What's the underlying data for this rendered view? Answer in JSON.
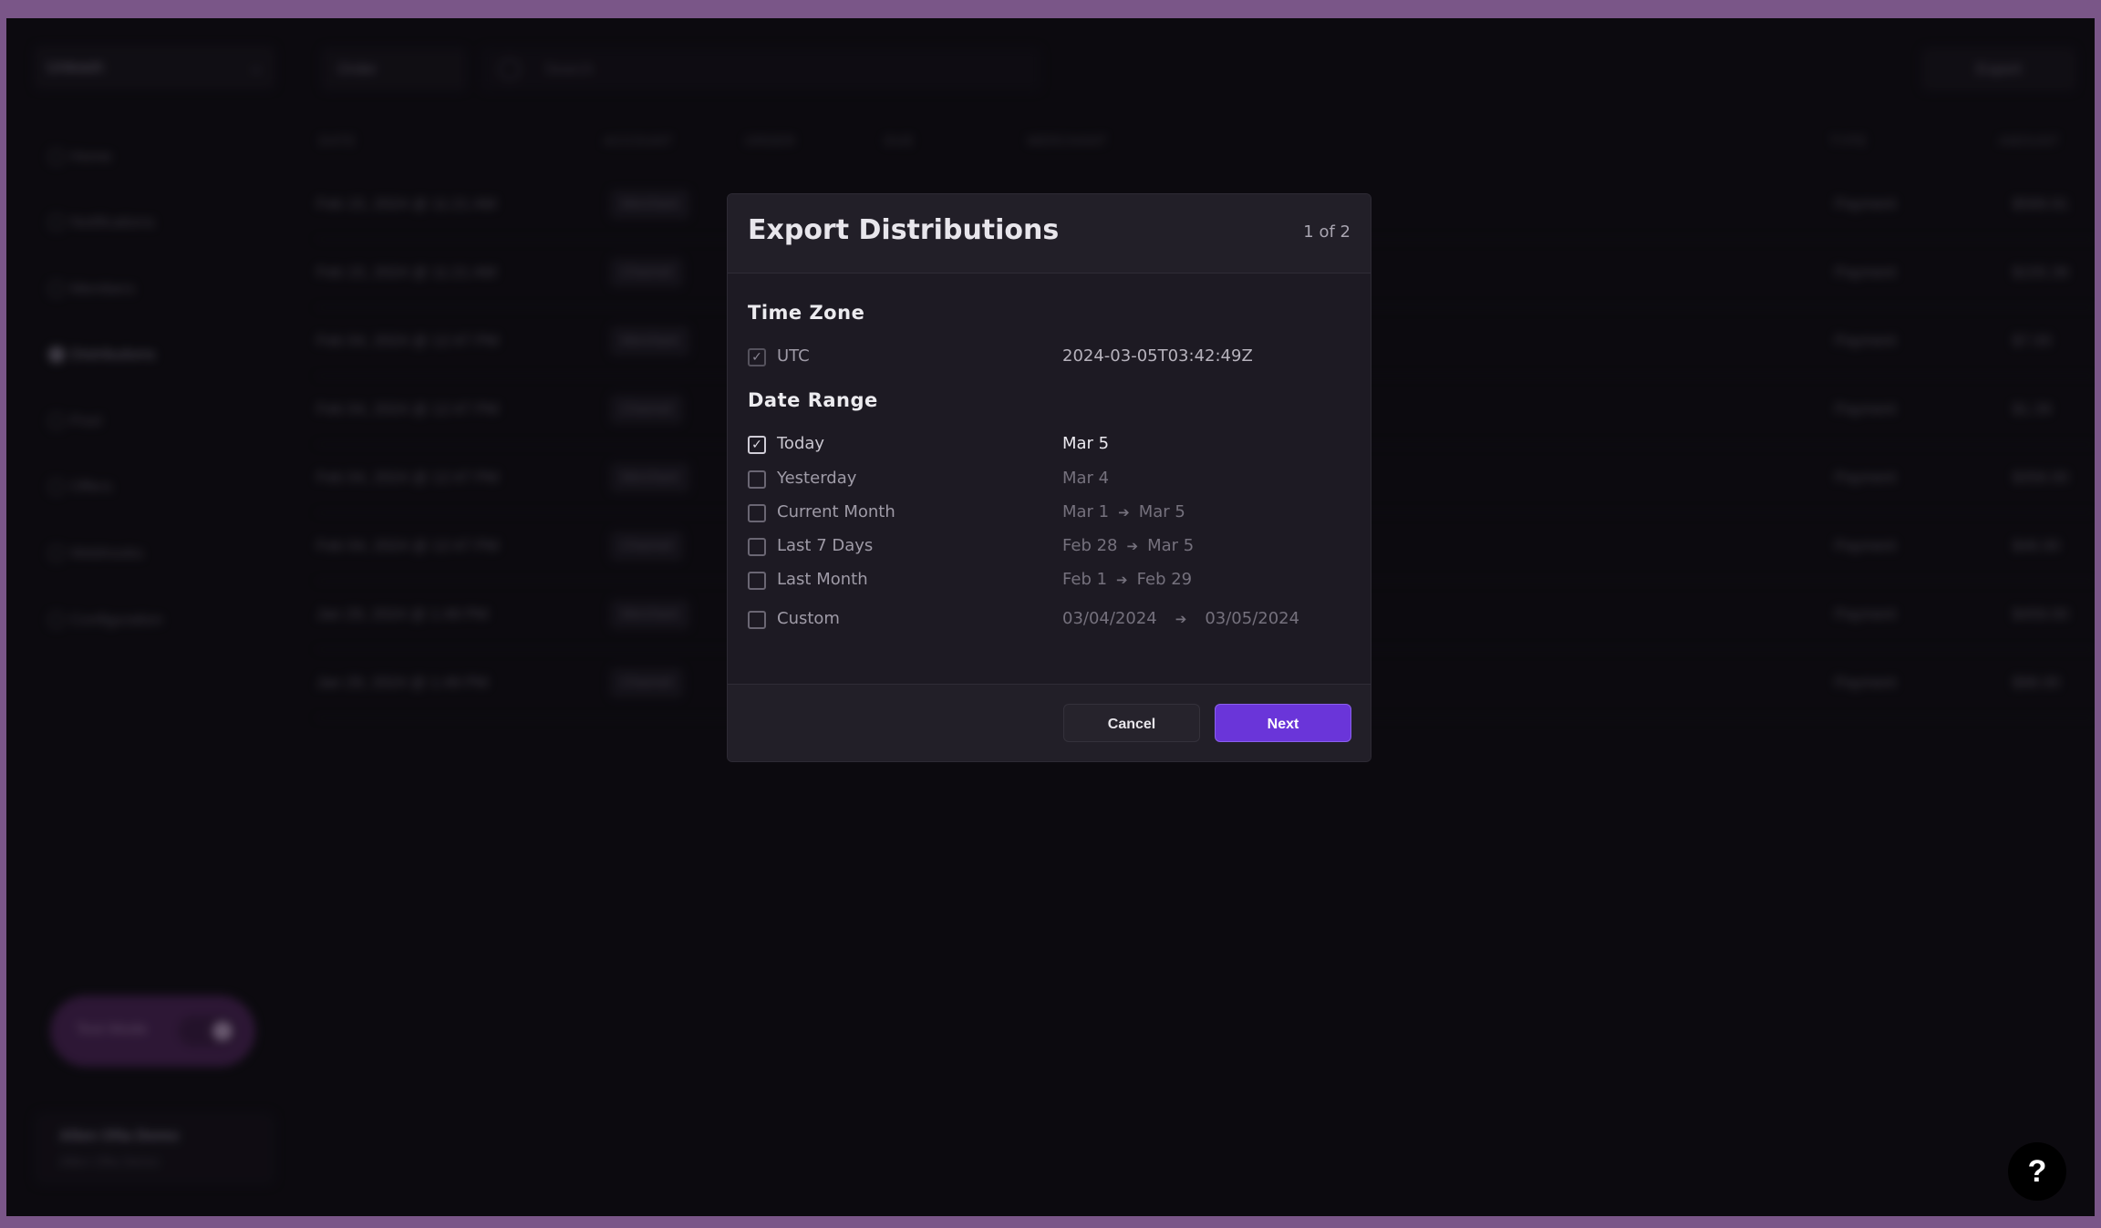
{
  "background": {
    "account_select": "Unleash",
    "nav": [
      {
        "label": "Home",
        "active": false
      },
      {
        "label": "Notifications",
        "active": false
      },
      {
        "label": "Members",
        "active": false
      },
      {
        "label": "Distributions",
        "active": true
      },
      {
        "label": "Pool",
        "active": false
      },
      {
        "label": "Offers",
        "active": false
      },
      {
        "label": "Webhooks",
        "active": false
      },
      {
        "label": "Configuration",
        "active": false
      }
    ],
    "test_mode_label": "Test Mode",
    "user": {
      "name": "Allen Ofia Demo",
      "email": "Allen Ofia Demo"
    },
    "filter_label": "Order",
    "search_placeholder": "Search",
    "export_label": "Export",
    "table": {
      "headers": [
        "DATE",
        "ACCOUNT",
        "ORDER",
        "DUE",
        "MERCHANT",
        "TYPE",
        "AMOUNT"
      ],
      "rows": [
        {
          "date": "Feb 15, 2024 @ 11:21 AM",
          "account": "Merchant",
          "type": "Payment",
          "amount": "$589.91"
        },
        {
          "date": "Feb 15, 2024 @ 11:21 AM",
          "account": "Channel",
          "type": "Payment",
          "amount": "$155.39"
        },
        {
          "date": "Feb 04, 2024 @ 12:47 PM",
          "account": "Merchant",
          "type": "Payment",
          "amount": "$7.00"
        },
        {
          "date": "Feb 04, 2024 @ 12:47 PM",
          "account": "Channel",
          "type": "Payment",
          "amount": "$1.39"
        },
        {
          "date": "Feb 04, 2024 @ 12:47 PM",
          "account": "Merchant",
          "type": "Payment",
          "amount": "$356.00"
        },
        {
          "date": "Feb 04, 2024 @ 12:47 PM",
          "account": "Channel",
          "type": "Payment",
          "amount": "$46.00"
        },
        {
          "date": "Jan 29, 2024 @ 1:49 PM",
          "account": "Merchant",
          "type": "Payment",
          "amount": "$459.00"
        },
        {
          "date": "Jan 29, 2024 @ 1:49 PM",
          "account": "Channel",
          "type": "Payment",
          "amount": "$98.00"
        }
      ]
    }
  },
  "modal": {
    "title": "Export Distributions",
    "step": "1 of 2",
    "time_zone": {
      "title": "Time Zone",
      "option": {
        "label": "UTC",
        "value": "2024-03-05T03:42:49Z",
        "checked": true
      }
    },
    "date_range": {
      "title": "Date Range",
      "options": [
        {
          "label": "Today",
          "from": "Mar 5",
          "to": "",
          "checked": true
        },
        {
          "label": "Yesterday",
          "from": "Mar 4",
          "to": "",
          "checked": false
        },
        {
          "label": "Current Month",
          "from": "Mar 1",
          "to": "Mar 5",
          "checked": false
        },
        {
          "label": "Last 7 Days",
          "from": "Feb 28",
          "to": "Mar 5",
          "checked": false
        },
        {
          "label": "Last Month",
          "from": "Feb 1",
          "to": "Feb 29",
          "checked": false
        },
        {
          "label": "Custom",
          "from": "03/04/2024",
          "to": "03/05/2024",
          "checked": false
        }
      ]
    },
    "cancel_label": "Cancel",
    "next_label": "Next"
  },
  "help_label": "?",
  "colors": {
    "accent": "#6a35d9",
    "frame": "#7a5688"
  }
}
